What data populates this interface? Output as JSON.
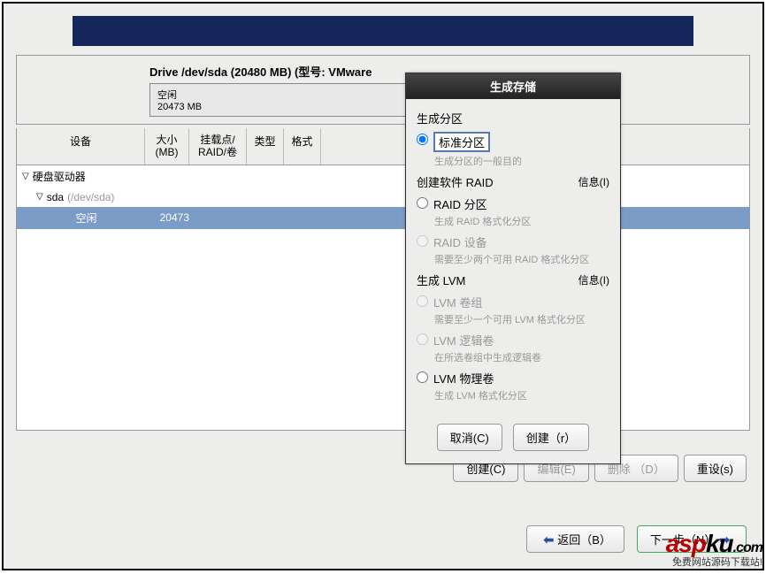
{
  "top_bar": {},
  "drive": {
    "title": "Drive /dev/sda (20480 MB) (型号: VMware",
    "status": "空闲",
    "size": "20473 MB"
  },
  "headers": {
    "device": "设备",
    "size": "大小\n(MB)",
    "mount": "挂载点/\nRAID/卷",
    "type": "类型",
    "format": "格式"
  },
  "tree": {
    "root": "硬盘驱动器",
    "sda": "sda",
    "sda_path": "(/dev/sda)",
    "free": "空闲",
    "free_size": "20473"
  },
  "main_buttons": {
    "create": "创建(C)",
    "edit": "编辑(E)",
    "delete": "删除 （D）",
    "reset": "重设(s)"
  },
  "nav_buttons": {
    "back": "返回（B）",
    "next": "下一步（N）"
  },
  "dialog": {
    "title": "生成存储",
    "sect_partition": "生成分区",
    "opt_standard": "标准分区",
    "opt_standard_sub": "生成分区的一般目的",
    "sect_raid": "创建软件 RAID",
    "info": "信息(I)",
    "opt_raid_part": "RAID 分区",
    "opt_raid_part_sub": "生成 RAID 格式化分区",
    "opt_raid_dev": "RAID 设备",
    "opt_raid_dev_sub": "需要至少两个可用 RAID 格式化分区",
    "sect_lvm": "生成 LVM",
    "opt_lvm_vg": "LVM 卷组",
    "opt_lvm_vg_sub": "需要至少一个可用 LVM 格式化分区",
    "opt_lvm_lv": "LVM 逻辑卷",
    "opt_lvm_lv_sub": "在所选卷组中生成逻辑卷",
    "opt_lvm_pv": "LVM 物理卷",
    "opt_lvm_pv_sub": "生成 LVM 格式化分区",
    "btn_cancel": "取消(C)",
    "btn_create": "创建（r）"
  },
  "watermark": {
    "text1": "asp",
    "text2": "ku",
    "text3": ".com",
    "sub": "免费网站源码下载站!"
  }
}
